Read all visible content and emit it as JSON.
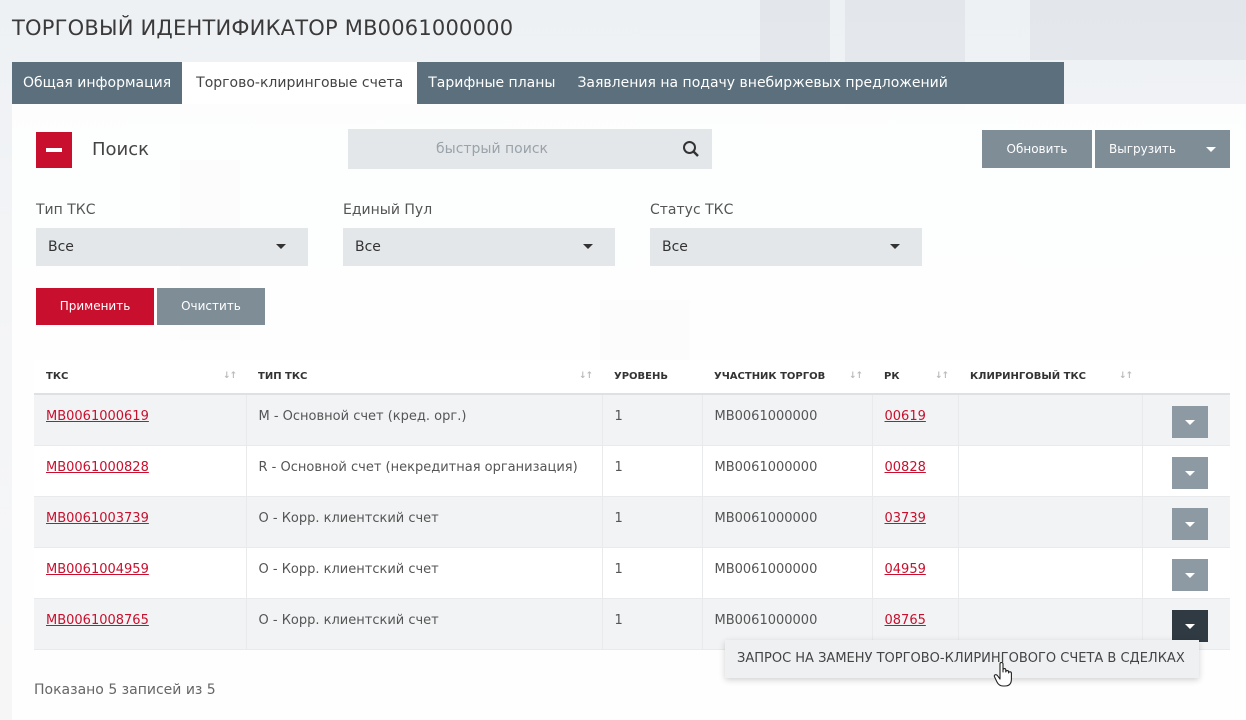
{
  "page_title": "ТОРГОВЫЙ ИДЕНТИФИКАТОР MB0061000000",
  "tabs": [
    {
      "label": "Общая информация",
      "active": false
    },
    {
      "label": "Торгово-клиринговые счета",
      "active": true
    },
    {
      "label": "Тарифные планы",
      "active": false
    },
    {
      "label": "Заявления на подачу внебиржевых предложений",
      "active": false
    }
  ],
  "search": {
    "label": "Поиск",
    "placeholder": "быстрый поиск",
    "toggle_icon": "minus-icon",
    "search_icon": "search-icon"
  },
  "toolbar": {
    "refresh_label": "Обновить",
    "export_label": "Выгрузить"
  },
  "filters": [
    {
      "label": "Тип ТКС",
      "value": "Все"
    },
    {
      "label": "Единый Пул",
      "value": "Все"
    },
    {
      "label": "Статус ТКС",
      "value": "Все"
    }
  ],
  "actions": {
    "apply_label": "Применить",
    "clear_label": "Очистить"
  },
  "table": {
    "headers": [
      "ТКС",
      "ТИП ТКС",
      "УРОВЕНЬ",
      "УЧАСТНИК ТОРГОВ",
      "РК",
      "КЛИРИНГОВЫЙ ТКС"
    ],
    "rows": [
      {
        "tks": "MB0061000619",
        "type": "М - Основной счет (кред. орг.)",
        "level": "1",
        "participant": "MB0061000000",
        "rk": "00619",
        "clearing": ""
      },
      {
        "tks": "MB0061000828",
        "type": "R - Основной счет (некредитная организация)",
        "level": "1",
        "participant": "MB0061000000",
        "rk": "00828",
        "clearing": ""
      },
      {
        "tks": "MB0061003739",
        "type": "О - Корр. клиентский счет",
        "level": "1",
        "participant": "MB0061000000",
        "rk": "03739",
        "clearing": ""
      },
      {
        "tks": "MB0061004959",
        "type": "О - Корр. клиентский счет",
        "level": "1",
        "participant": "MB0061000000",
        "rk": "04959",
        "clearing": ""
      },
      {
        "tks": "MB0061008765",
        "type": "О - Корр. клиентский счет",
        "level": "1",
        "participant": "MB0061000000",
        "rk": "08765",
        "clearing": ""
      }
    ]
  },
  "row_menu": {
    "item": "ЗАПРОС НА ЗАМЕНУ ТОРГОВО-КЛИРИНГОВОГО СЧЕТА В СДЕЛКАХ"
  },
  "footer": {
    "count_text": "Показано 5 записей из 5"
  },
  "colors": {
    "accent_red": "#c8102e",
    "tab_bar": "#5b6f7c",
    "grey_button": "#7f8d97",
    "active_row_button": "#2f3a42"
  }
}
